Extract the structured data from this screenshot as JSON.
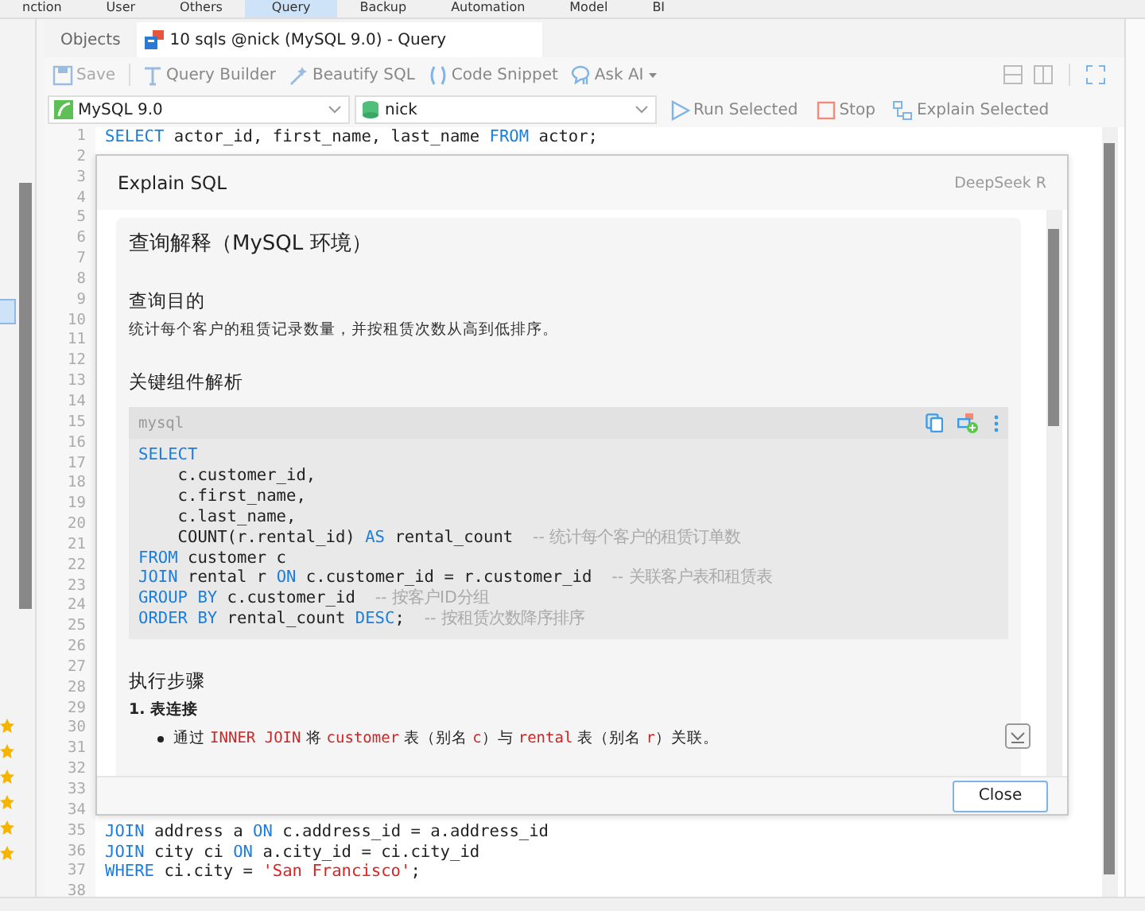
{
  "menu": [
    {
      "label": "nction",
      "selected": false
    },
    {
      "label": "User",
      "selected": false
    },
    {
      "label": "Others",
      "selected": false
    },
    {
      "label": "Query",
      "selected": true
    },
    {
      "label": "Backup",
      "selected": false
    },
    {
      "label": "Automation",
      "selected": false
    },
    {
      "label": "Model",
      "selected": false
    },
    {
      "label": "BI",
      "selected": false
    }
  ],
  "tabs": [
    {
      "label": "Objects",
      "selected": false,
      "kind": "plain"
    },
    {
      "label": "10 sqls @nick (MySQL 9.0) - Query",
      "selected": true,
      "kind": "query"
    }
  ],
  "toolbar": [
    {
      "label": "Save",
      "kind": "save",
      "disabled": true
    },
    {
      "label": "Query Builder",
      "kind": "builder",
      "disabled": false
    },
    {
      "label": "Beautify SQL",
      "kind": "beautify",
      "disabled": false
    },
    {
      "label": "Code Snippet",
      "kind": "snippet",
      "disabled": false
    },
    {
      "label": "Ask AI",
      "kind": "ai",
      "disabled": false
    }
  ],
  "connection": {
    "server": "MySQL 9.0",
    "database": "nick"
  },
  "actions": [
    {
      "label": "Run Selected",
      "kind": "run"
    },
    {
      "label": "Stop",
      "kind": "stop"
    },
    {
      "label": "Explain Selected",
      "kind": "explain"
    }
  ],
  "editor": {
    "lines": [
      {
        "number": "1",
        "tokens": [
          {
            "kind": "kw",
            "text": "SELECT"
          },
          {
            "kind": "plain",
            "text": " actor_id, first_name, last_name "
          },
          {
            "kind": "kw",
            "text": "FROM"
          },
          {
            "kind": "plain",
            "text": " actor;"
          }
        ]
      },
      {
        "number": "2"
      },
      {
        "number": "3"
      },
      {
        "number": "4"
      },
      {
        "number": "5"
      },
      {
        "number": "6"
      },
      {
        "number": "7"
      },
      {
        "number": "8"
      },
      {
        "number": "9"
      },
      {
        "number": "10"
      },
      {
        "number": "11"
      },
      {
        "number": "12"
      },
      {
        "number": "13"
      },
      {
        "number": "14"
      },
      {
        "number": "15"
      },
      {
        "number": "16"
      },
      {
        "number": "17"
      },
      {
        "number": "18"
      },
      {
        "number": "19"
      },
      {
        "number": "20"
      },
      {
        "number": "21"
      },
      {
        "number": "22"
      },
      {
        "number": "23"
      },
      {
        "number": "24"
      },
      {
        "number": "25"
      },
      {
        "number": "26"
      },
      {
        "number": "27"
      },
      {
        "number": "28"
      },
      {
        "number": "29"
      },
      {
        "number": "30"
      },
      {
        "number": "31"
      },
      {
        "number": "32"
      },
      {
        "number": "33"
      },
      {
        "number": "34"
      },
      {
        "number": "35",
        "tokens": [
          {
            "kind": "kw",
            "text": "JOIN"
          },
          {
            "kind": "plain",
            "text": " address a "
          },
          {
            "kind": "kw",
            "text": "ON"
          },
          {
            "kind": "plain",
            "text": " c.address_id = a.address_id"
          }
        ]
      },
      {
        "number": "36",
        "tokens": [
          {
            "kind": "kw",
            "text": "JOIN"
          },
          {
            "kind": "plain",
            "text": " city ci "
          },
          {
            "kind": "kw",
            "text": "ON"
          },
          {
            "kind": "plain",
            "text": " a.city_id = ci.city_id"
          }
        ]
      },
      {
        "number": "37",
        "tokens": [
          {
            "kind": "kw",
            "text": "WHERE"
          },
          {
            "kind": "plain",
            "text": " ci.city = "
          },
          {
            "kind": "string",
            "text": "'San Francisco'"
          },
          {
            "kind": "plain",
            "text": ";"
          }
        ]
      },
      {
        "number": "38"
      }
    ]
  },
  "dialog": {
    "title": "Explain SQL",
    "model": "DeepSeek R",
    "close": "Close",
    "content": [
      {
        "kind": "h1",
        "text": "查询解释（MySQL 环境）"
      },
      {
        "kind": "h2",
        "text": "查询目的"
      },
      {
        "kind": "p",
        "text": "统计每个客户的租赁记录数量，并按租赁次数从高到低排序。"
      },
      {
        "kind": "h2",
        "text": "关键组件解析"
      },
      {
        "kind": "code",
        "language": "mysql",
        "lines": [
          [
            {
              "kind": "kw",
              "text": "SELECT"
            }
          ],
          [
            {
              "kind": "plain",
              "text": "    c.customer_id,"
            }
          ],
          [
            {
              "kind": "plain",
              "text": "    c.first_name,"
            }
          ],
          [
            {
              "kind": "plain",
              "text": "    c.last_name,"
            }
          ],
          [
            {
              "kind": "plain",
              "text": "    COUNT(r.rental_id) "
            },
            {
              "kind": "kw",
              "text": "AS"
            },
            {
              "kind": "plain",
              "text": " rental_count  "
            },
            {
              "kind": "comment",
              "text": "-- 统计每个客户的租赁订单数"
            }
          ],
          [
            {
              "kind": "kw",
              "text": "FROM"
            },
            {
              "kind": "plain",
              "text": " customer c"
            }
          ],
          [
            {
              "kind": "kw",
              "text": "JOIN"
            },
            {
              "kind": "plain",
              "text": " rental r "
            },
            {
              "kind": "kw",
              "text": "ON"
            },
            {
              "kind": "plain",
              "text": " c.customer_id = r.customer_id  "
            },
            {
              "kind": "comment",
              "text": "-- 关联客户表和租赁表"
            }
          ],
          [
            {
              "kind": "kw",
              "text": "GROUP BY"
            },
            {
              "kind": "plain",
              "text": " c.customer_id  "
            },
            {
              "kind": "comment",
              "text": "-- 按客户ID分组"
            }
          ],
          [
            {
              "kind": "kw",
              "text": "ORDER BY"
            },
            {
              "kind": "plain",
              "text": " rental_count "
            },
            {
              "kind": "kw",
              "text": "DESC"
            },
            {
              "kind": "plain",
              "text": ";  "
            },
            {
              "kind": "comment",
              "text": "-- 按租赁次数降序排序"
            }
          ]
        ]
      },
      {
        "kind": "h2",
        "text": "执行步骤"
      },
      {
        "kind": "h3",
        "text": "1. 表连接"
      },
      {
        "kind": "bullet",
        "tokens": [
          {
            "kind": "text",
            "text": "通过 "
          },
          {
            "kind": "code",
            "text": "INNER JOIN"
          },
          {
            "kind": "text",
            "text": " 将 "
          },
          {
            "kind": "code",
            "text": "customer"
          },
          {
            "kind": "text",
            "text": " 表（别名 "
          },
          {
            "kind": "code",
            "text": "c"
          },
          {
            "kind": "text",
            "text": "）与 "
          },
          {
            "kind": "code",
            "text": "rental"
          },
          {
            "kind": "text",
            "text": " 表（别名 "
          },
          {
            "kind": "code",
            "text": "r"
          },
          {
            "kind": "text",
            "text": "）关联。"
          }
        ]
      }
    ]
  }
}
